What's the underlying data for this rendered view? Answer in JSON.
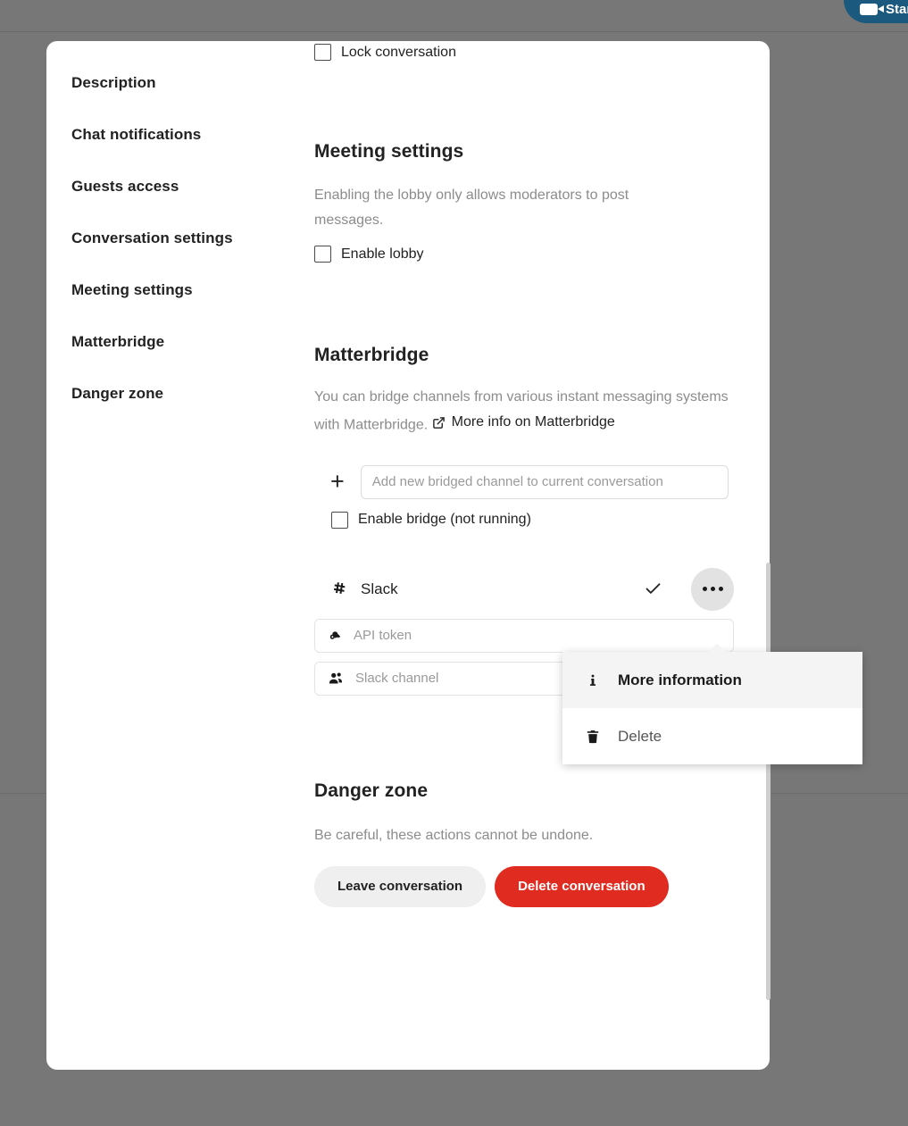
{
  "header": {
    "start_call_label": "Start",
    "start_call_icon": "video-camera-icon",
    "accent_color": "#1b5a7e"
  },
  "backdrop": {
    "overlay_color": "#777777"
  },
  "modal": {
    "nav": {
      "items": [
        {
          "label": "Description"
        },
        {
          "label": "Chat notifications"
        },
        {
          "label": "Guests access"
        },
        {
          "label": "Conversation settings"
        },
        {
          "label": "Meeting settings"
        },
        {
          "label": "Matterbridge"
        },
        {
          "label": "Danger zone"
        }
      ]
    },
    "conversation_settings": {
      "lock_conversation_label": "Lock conversation",
      "lock_conversation_checked": false
    },
    "meeting_settings": {
      "title": "Meeting settings",
      "description": "Enabling the lobby only allows moderators to post messages.",
      "enable_lobby_label": "Enable lobby",
      "enable_lobby_checked": false
    },
    "matterbridge": {
      "title": "Matterbridge",
      "description": "You can bridge channels from various instant messaging systems with Matterbridge.",
      "more_info_label": "More info on Matterbridge",
      "more_info_icon": "external-link-icon",
      "add_icon": "plus-icon",
      "add_channel_placeholder": "Add new bridged channel to current conversation",
      "add_channel_value": "",
      "enable_bridge_label": "Enable bridge (not running)",
      "enable_bridge_checked": false,
      "parts": [
        {
          "name": "Slack",
          "icon": "slack-hash-icon",
          "status_icon": "check-icon",
          "menu_icon": "more-dots-icon",
          "fields": [
            {
              "icon": "key-icon",
              "placeholder": "API token",
              "value": ""
            },
            {
              "icon": "users-icon",
              "placeholder": "Slack channel",
              "value": ""
            }
          ]
        }
      ]
    },
    "danger_zone": {
      "title": "Danger zone",
      "description": "Be careful, these actions cannot be undone.",
      "leave_label": "Leave conversation",
      "delete_label": "Delete conversation",
      "delete_color": "#e02b20"
    }
  },
  "actions_menu": {
    "items": [
      {
        "label": "More information",
        "icon": "info-icon",
        "active": true
      },
      {
        "label": "Delete",
        "icon": "trash-icon",
        "active": false
      }
    ]
  }
}
